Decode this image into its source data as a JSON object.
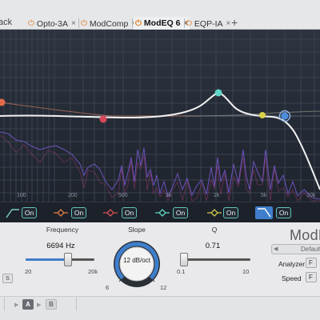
{
  "tabbar": {
    "title": "ack",
    "tabs": [
      {
        "label": "Opto-3A",
        "active": false
      },
      {
        "label": "ModComp",
        "active": false
      },
      {
        "label": "ModEQ 6",
        "active": true
      },
      {
        "label": "EQP-IA",
        "active": false
      }
    ],
    "add_symbol": "+",
    "close_symbol": "×",
    "power_symbol": "⏻"
  },
  "eq_display": {
    "freq_ticks": [
      "100",
      "200",
      "500",
      "1k",
      "2k",
      "5k",
      "10k"
    ],
    "node_colors": [
      "#e66a4a",
      "#d9485a",
      "#5fd6c6",
      "#d7d24a",
      "#4a8ee0"
    ],
    "curve_color": "#f2f2f2",
    "spectrum_color": "#7a5bd6"
  },
  "bands": [
    {
      "icon": "low-cut-icon",
      "state": "On",
      "color": "#7ad0c7"
    },
    {
      "icon": "bell-icon",
      "state": "On",
      "color": "#e07a45"
    },
    {
      "icon": "bell-icon",
      "state": "On",
      "color": "#d95058"
    },
    {
      "icon": "bell-icon",
      "state": "On",
      "color": "#5fd6c6"
    },
    {
      "icon": "bell-icon",
      "state": "On",
      "color": "#d2c94a"
    },
    {
      "icon": "high-cut-icon",
      "state": "On",
      "color": "#ffffff",
      "selected": true
    }
  ],
  "panel": {
    "frequency": {
      "label": "Frequency",
      "value": "6694 Hz",
      "min": "20",
      "max": "20k",
      "position": 0.62
    },
    "slope": {
      "label": "Slope",
      "value": "12 dB/oct",
      "min": "6",
      "max": "12",
      "level": 1.0
    },
    "q": {
      "label": "Q",
      "value": "0.71",
      "min": "0.1",
      "max": "10",
      "position": 0.02
    },
    "solo_label": "S",
    "brand": "ModE",
    "preset": {
      "value": "Default",
      "arrow": "◀"
    },
    "analyzer": {
      "label": "Analyzer",
      "value": "F"
    },
    "speed": {
      "label": "Speed",
      "value": "F"
    }
  },
  "footer": {
    "a_label": "A",
    "b_label": "B",
    "arrow": "▶"
  }
}
